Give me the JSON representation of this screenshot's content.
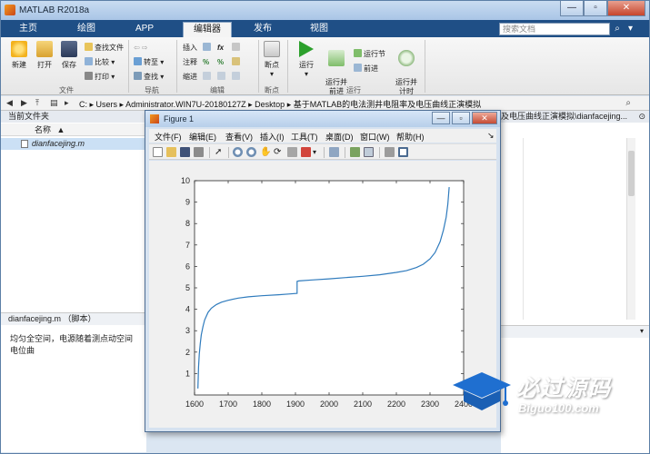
{
  "window": {
    "title": "MATLAB R2018a",
    "minimize": "—",
    "maximize": "▫",
    "close": "✕"
  },
  "ribbon_tabs": [
    {
      "label": "主页"
    },
    {
      "label": "绘图"
    },
    {
      "label": "APP"
    },
    {
      "label": "编辑器"
    },
    {
      "label": "发布"
    },
    {
      "label": "视图"
    }
  ],
  "search": {
    "placeholder": "搜索文档"
  },
  "ribbon": {
    "file": {
      "group_label": "文件",
      "new": "新建",
      "open": "打开",
      "save": "保存",
      "find_files": "查找文件",
      "compare": "比较",
      "print": "打印"
    },
    "navigate": {
      "group_label": "导航",
      "goto": "转至",
      "find": "查找"
    },
    "edit": {
      "group_label": "编辑",
      "insert": "插入",
      "comment": "注释",
      "indent": "缩进",
      "fx": "fx"
    },
    "breakpoints": {
      "group_label": "断点",
      "breakpoints": "断点"
    },
    "run": {
      "group_label": "运行",
      "run": "运行",
      "run_advance": "运行并\n前进",
      "run_section": "运行节",
      "advance": "前进",
      "run_time": "运行并\n计时"
    }
  },
  "address_bar": {
    "path": [
      "C:",
      "Users",
      "Administrator.WIN7U-20180127Z",
      "Desktop",
      "基于MATLAB的电法测井电阻率及电压曲线正演模拟"
    ]
  },
  "current_folder": {
    "title": "当前文件夹",
    "column_name": "名称",
    "sort_arrow": "▲",
    "files": [
      {
        "name": "dianfacejing.m"
      }
    ]
  },
  "details": {
    "title": "dianfacejing.m （脚本）",
    "text": "均匀全空间，电源随着测点动空间电位曲"
  },
  "editor": {
    "title_tail": "及电压曲线正演模拟\\dianfacejing..."
  },
  "figure": {
    "title": "Figure 1",
    "menus": [
      {
        "label": "文件(F)"
      },
      {
        "label": "编辑(E)"
      },
      {
        "label": "查看(V)"
      },
      {
        "label": "插入(I)"
      },
      {
        "label": "工具(T)"
      },
      {
        "label": "桌面(D)"
      },
      {
        "label": "窗口(W)"
      },
      {
        "label": "帮助(H)"
      }
    ]
  },
  "chart_data": {
    "type": "line",
    "title": "",
    "xlabel": "",
    "ylabel": "",
    "xlim": [
      1600,
      2400
    ],
    "ylim": [
      0,
      10
    ],
    "xticks": [
      1600,
      1700,
      1800,
      1900,
      2000,
      2100,
      2200,
      2300,
      2400
    ],
    "yticks": [
      1,
      2,
      3,
      4,
      5,
      6,
      7,
      8,
      9,
      10
    ],
    "grid": false,
    "line_color": "#2f7bbd",
    "series": [
      {
        "x": [
          1610,
          1612,
          1614,
          1617,
          1620,
          1625,
          1630,
          1640,
          1650,
          1665,
          1680,
          1700,
          1730,
          1760,
          1800,
          1850,
          1880,
          1905,
          1905,
          1910,
          1950,
          2000,
          2050,
          2100,
          2150,
          2200,
          2230,
          2260,
          2280,
          2300,
          2315,
          2330,
          2340,
          2348,
          2353,
          2357
        ],
        "y": [
          0.3,
          1.3,
          1.9,
          2.4,
          2.8,
          3.2,
          3.5,
          3.85,
          4.05,
          4.22,
          4.33,
          4.42,
          4.52,
          4.58,
          4.63,
          4.68,
          4.71,
          4.74,
          5.3,
          5.32,
          5.37,
          5.42,
          5.48,
          5.54,
          5.61,
          5.72,
          5.8,
          5.95,
          6.1,
          6.35,
          6.65,
          7.15,
          7.7,
          8.3,
          8.9,
          9.7
        ]
      }
    ]
  },
  "watermark": {
    "big": "必过源码",
    "small": "Biguo100.com"
  }
}
